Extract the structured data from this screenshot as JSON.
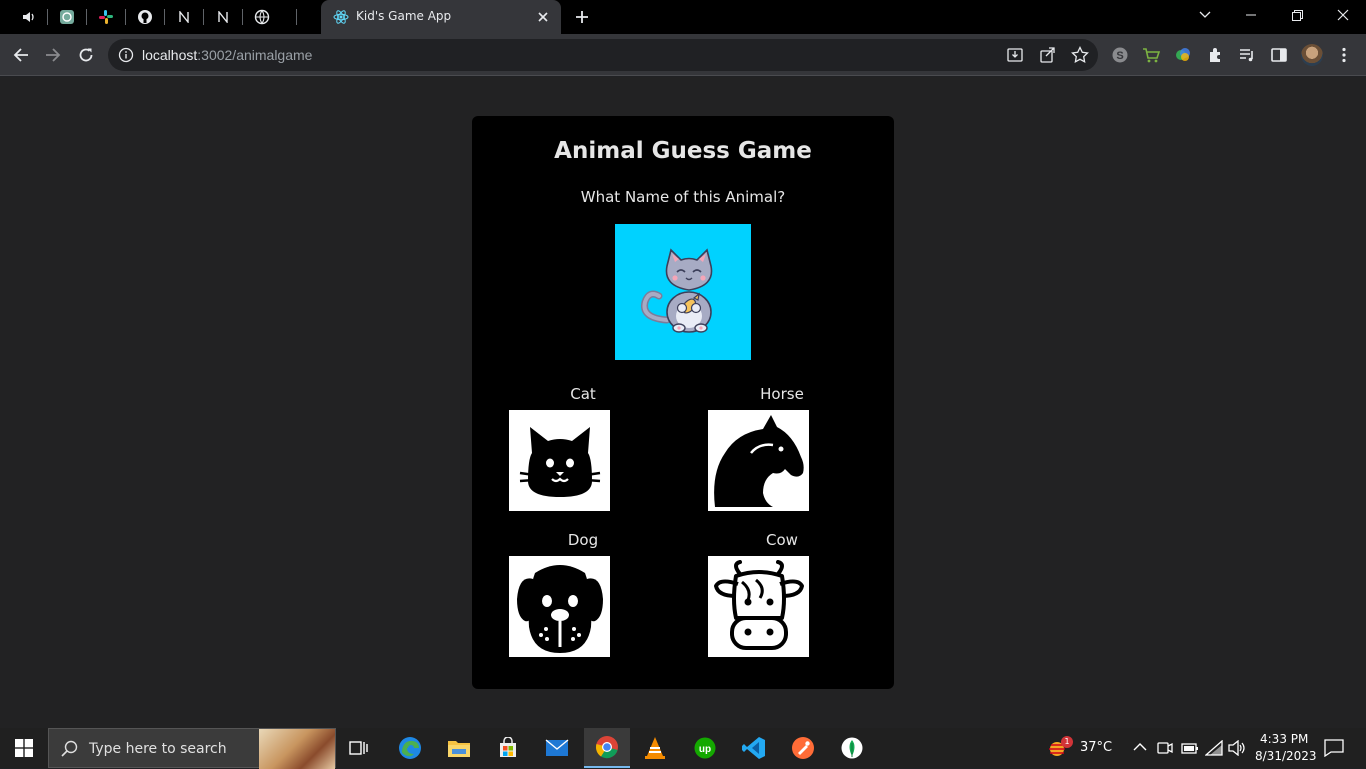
{
  "browser": {
    "tab": {
      "title": "Kid's Game App"
    },
    "url": {
      "host": "localhost",
      "path": ":3002/animalgame"
    }
  },
  "game": {
    "title": "Animal Guess Game",
    "question": "What Name of this Animal?",
    "image": "cat-cartoon-with-fish",
    "options": [
      {
        "label": "Cat",
        "icon": "cat-face-icon"
      },
      {
        "label": "Horse",
        "icon": "horse-head-icon"
      },
      {
        "label": "Dog",
        "icon": "dog-face-icon"
      },
      {
        "label": "Cow",
        "icon": "cow-face-icon"
      }
    ]
  },
  "taskbar": {
    "search_placeholder": "Type here to search",
    "weather": {
      "temp": "37°C",
      "badge": "1"
    },
    "clock": {
      "time": "4:33 PM",
      "date": "8/31/2023"
    }
  },
  "colors": {
    "image_bg": "#00d2ff",
    "card_bg": "#000000",
    "page_bg": "#222223"
  }
}
